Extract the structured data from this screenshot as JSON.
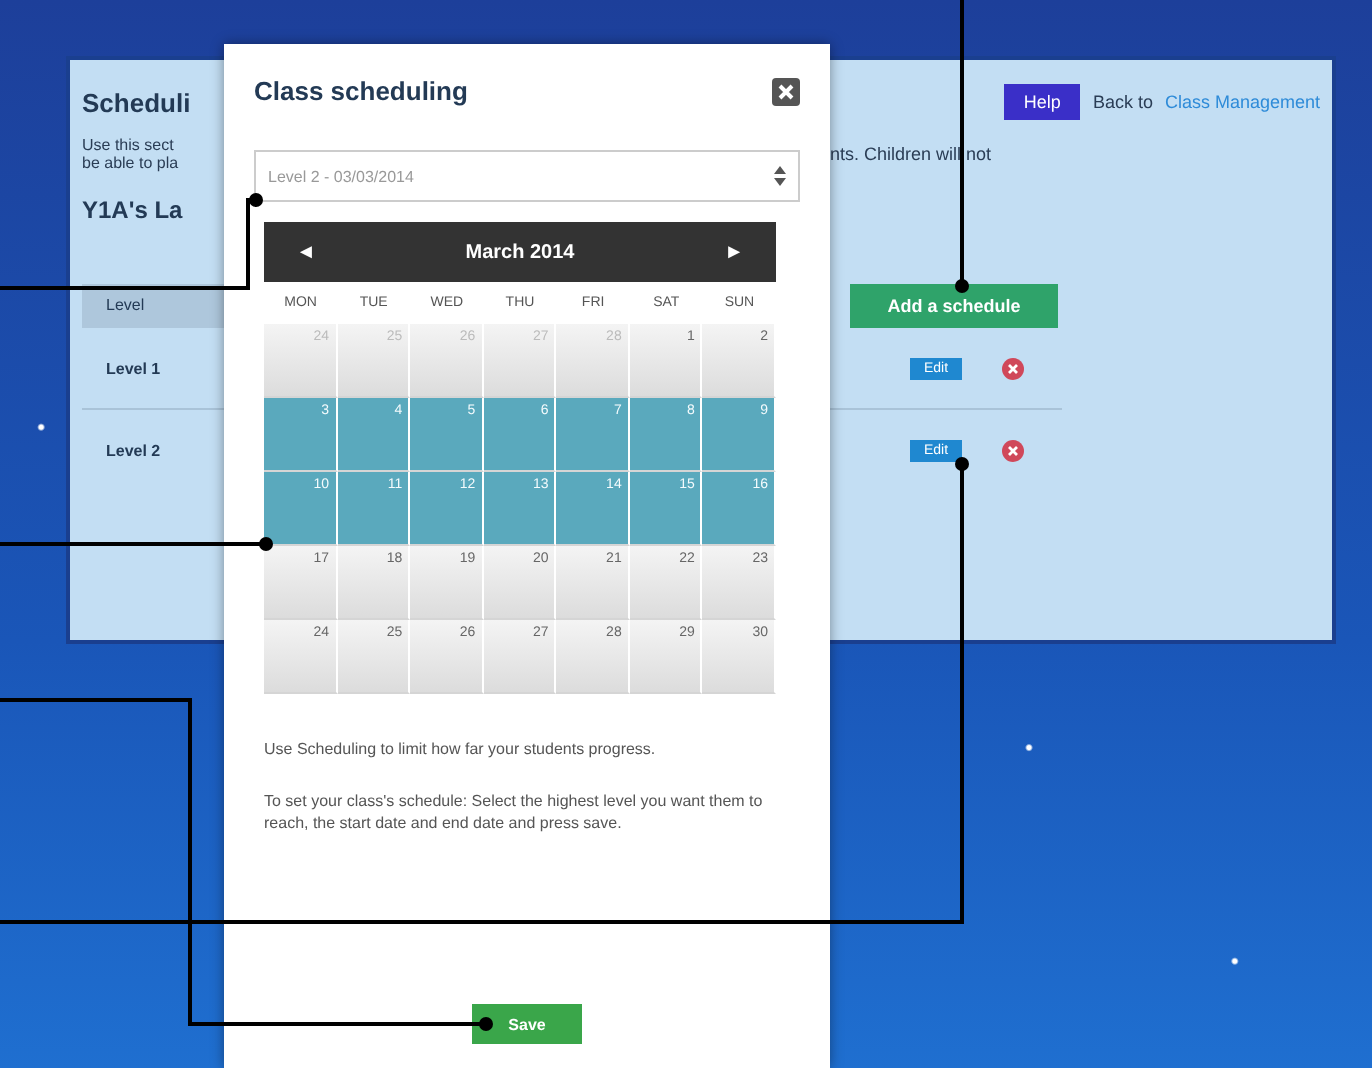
{
  "page": {
    "title": "Scheduli",
    "intro_left": [
      "Use this sect",
      "be able to pla"
    ],
    "intro_right": "nts. Children will not",
    "class_heading": "Y1A's La",
    "help_button": "Help",
    "back_text": "Back to",
    "back_link": "Class Management",
    "add_button": "Add a schedule",
    "table": {
      "column": "Level",
      "rows": [
        {
          "level": "Level 1",
          "edit": "Edit"
        },
        {
          "level": "Level 2",
          "edit": "Edit"
        }
      ]
    }
  },
  "dialog": {
    "title": "Class scheduling",
    "select_value": "Level 2 - 03/03/2014",
    "calendar": {
      "prev": "◄",
      "month": "March 2014",
      "next": "►",
      "weekdays": [
        "MON",
        "TUE",
        "WED",
        "THU",
        "FRI",
        "SAT",
        "SUN"
      ],
      "weeks": [
        [
          {
            "day": "24",
            "muted": true,
            "selected": false
          },
          {
            "day": "25",
            "muted": true,
            "selected": false
          },
          {
            "day": "26",
            "muted": true,
            "selected": false
          },
          {
            "day": "27",
            "muted": true,
            "selected": false
          },
          {
            "day": "28",
            "muted": true,
            "selected": false
          },
          {
            "day": "1",
            "muted": false,
            "selected": false
          },
          {
            "day": "2",
            "muted": false,
            "selected": false
          }
        ],
        [
          {
            "day": "3",
            "muted": false,
            "selected": true
          },
          {
            "day": "4",
            "muted": false,
            "selected": true
          },
          {
            "day": "5",
            "muted": false,
            "selected": true
          },
          {
            "day": "6",
            "muted": false,
            "selected": true
          },
          {
            "day": "7",
            "muted": false,
            "selected": true
          },
          {
            "day": "8",
            "muted": false,
            "selected": true
          },
          {
            "day": "9",
            "muted": false,
            "selected": true
          }
        ],
        [
          {
            "day": "10",
            "muted": false,
            "selected": true
          },
          {
            "day": "11",
            "muted": false,
            "selected": true
          },
          {
            "day": "12",
            "muted": false,
            "selected": true
          },
          {
            "day": "13",
            "muted": false,
            "selected": true
          },
          {
            "day": "14",
            "muted": false,
            "selected": true
          },
          {
            "day": "15",
            "muted": false,
            "selected": true
          },
          {
            "day": "16",
            "muted": false,
            "selected": true
          }
        ],
        [
          {
            "day": "17",
            "muted": false,
            "selected": false
          },
          {
            "day": "18",
            "muted": false,
            "selected": false
          },
          {
            "day": "19",
            "muted": false,
            "selected": false
          },
          {
            "day": "20",
            "muted": false,
            "selected": false
          },
          {
            "day": "21",
            "muted": false,
            "selected": false
          },
          {
            "day": "22",
            "muted": false,
            "selected": false
          },
          {
            "day": "23",
            "muted": false,
            "selected": false
          }
        ],
        [
          {
            "day": "24",
            "muted": false,
            "selected": false
          },
          {
            "day": "25",
            "muted": false,
            "selected": false
          },
          {
            "day": "26",
            "muted": false,
            "selected": false
          },
          {
            "day": "27",
            "muted": false,
            "selected": false
          },
          {
            "day": "28",
            "muted": false,
            "selected": false
          },
          {
            "day": "29",
            "muted": false,
            "selected": false
          },
          {
            "day": "30",
            "muted": false,
            "selected": false
          }
        ]
      ]
    },
    "paragraphs": [
      "Use Scheduling to limit how far your students progress.",
      "To set your class's schedule: Select the highest level you want them to reach, the start date and end date and press save."
    ],
    "save_button": "Save"
  }
}
